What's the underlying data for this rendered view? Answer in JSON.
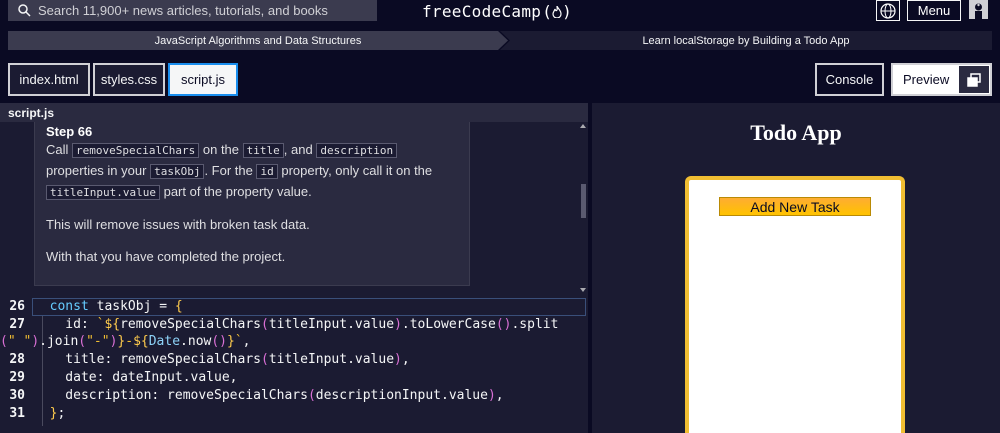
{
  "nav": {
    "search_placeholder": "Search 11,900+ news articles, tutorials, and books",
    "logo_text": "freeCodeCamp",
    "logo_flame": "(🔥)",
    "menu_label": "Menu"
  },
  "breadcrumb": {
    "course": "JavaScript Algorithms and Data Structures",
    "project": "Learn localStorage by Building a Todo App"
  },
  "tabs": [
    {
      "label": "index.html",
      "active": false
    },
    {
      "label": "styles.css",
      "active": false
    },
    {
      "label": "script.js",
      "active": true
    }
  ],
  "console_label": "Console",
  "preview_label": "Preview",
  "pane_title": "script.js",
  "instructions": {
    "step": "Step 66",
    "p1_a": "Call",
    "code1": "removeSpecialChars",
    "p1_b": "on the",
    "code2": "title",
    "p1_c": ", and",
    "code3": "description",
    "p1_d": "properties in your",
    "code4": "taskObj",
    "p1_e": ". For the",
    "code5": "id",
    "p1_f": "property, only call it on the",
    "code6": "titleInput.value",
    "p1_g": "part of the property value.",
    "p2": "This will remove issues with broken task data.",
    "p3": "With that you have completed the project."
  },
  "code_lines": [
    {
      "num": "26"
    },
    {
      "num": "27"
    },
    {
      "num": "28"
    },
    {
      "num": "29"
    },
    {
      "num": "30"
    },
    {
      "num": "31"
    }
  ],
  "preview": {
    "title": "Todo App",
    "add_button": "Add New Task"
  },
  "colors": {
    "background": "#0a0a23",
    "accent": "#f1be32",
    "active_tab_border": "#198eee"
  }
}
